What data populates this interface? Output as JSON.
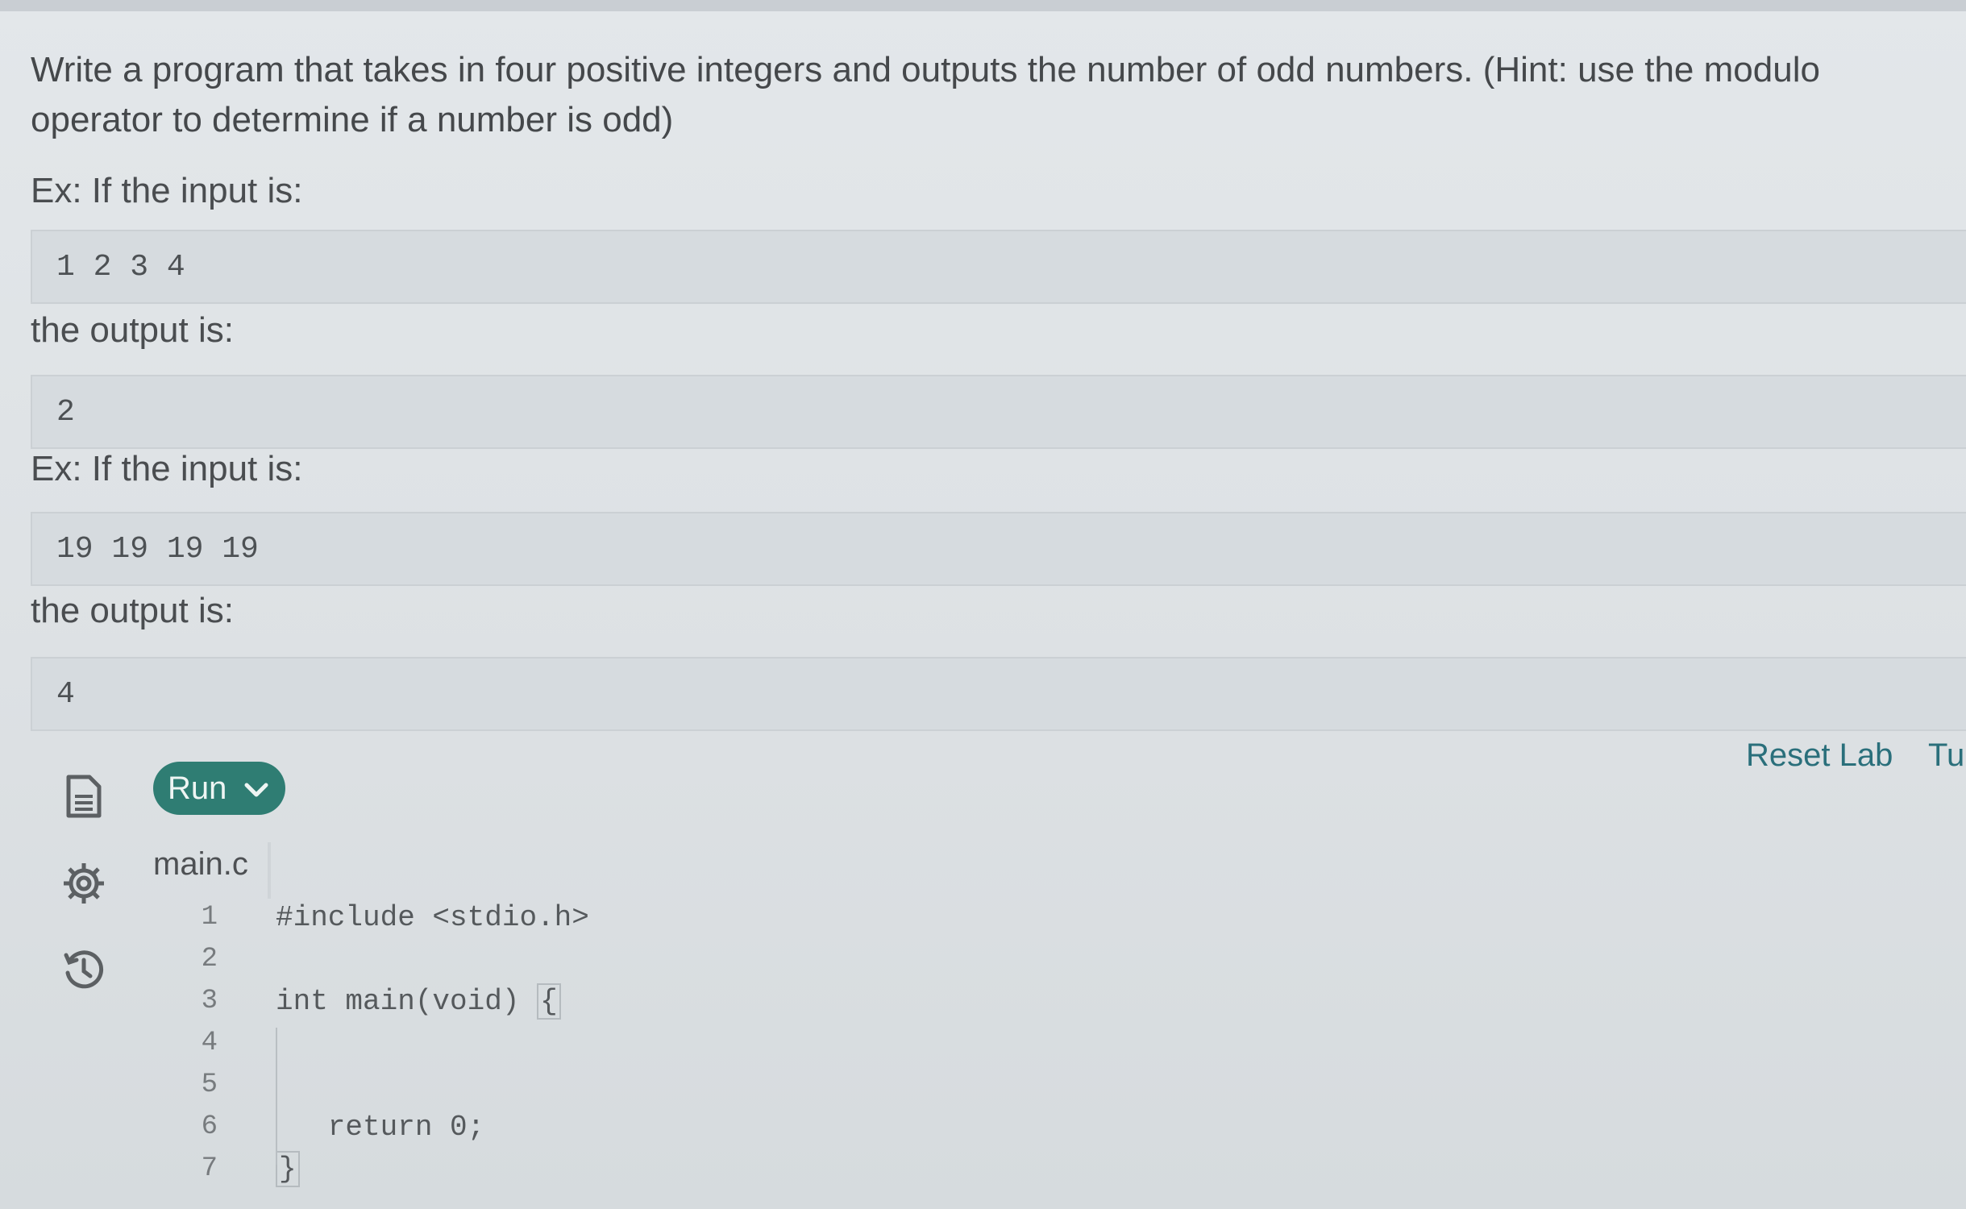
{
  "prompt_text": "Write a program that takes in four positive integers and outputs the number of odd numbers. (Hint: use the modulo operator to determine if a number is odd)",
  "examples": [
    {
      "input_label": "Ex: If the input is:",
      "input_value": "1 2 3 4",
      "output_label": "the output is:",
      "output_value": "2"
    },
    {
      "input_label": "Ex: If the input is:",
      "input_value": "19 19 19 19",
      "output_label": "the output is:",
      "output_value": "4"
    }
  ],
  "toolbar": {
    "run_label": "Run",
    "reset_label": "Reset Lab",
    "tutorial_label": "Tu",
    "icons": [
      "document-icon",
      "gear-icon",
      "history-icon"
    ]
  },
  "editor": {
    "filename": "main.c",
    "lines": [
      {
        "num": "1",
        "code": "#include <stdio.h>"
      },
      {
        "num": "2",
        "code": ""
      },
      {
        "num": "3",
        "code": "int main(void) "
      },
      {
        "num": "4",
        "code": ""
      },
      {
        "num": "5",
        "code": ""
      },
      {
        "num": "6",
        "code": "   return 0;"
      },
      {
        "num": "7",
        "code": ""
      }
    ],
    "open_brace": "{",
    "close_brace": "}"
  },
  "colors": {
    "accent": "#2f7d73",
    "link": "#2a6f7b",
    "background": "#e0e4e7"
  }
}
